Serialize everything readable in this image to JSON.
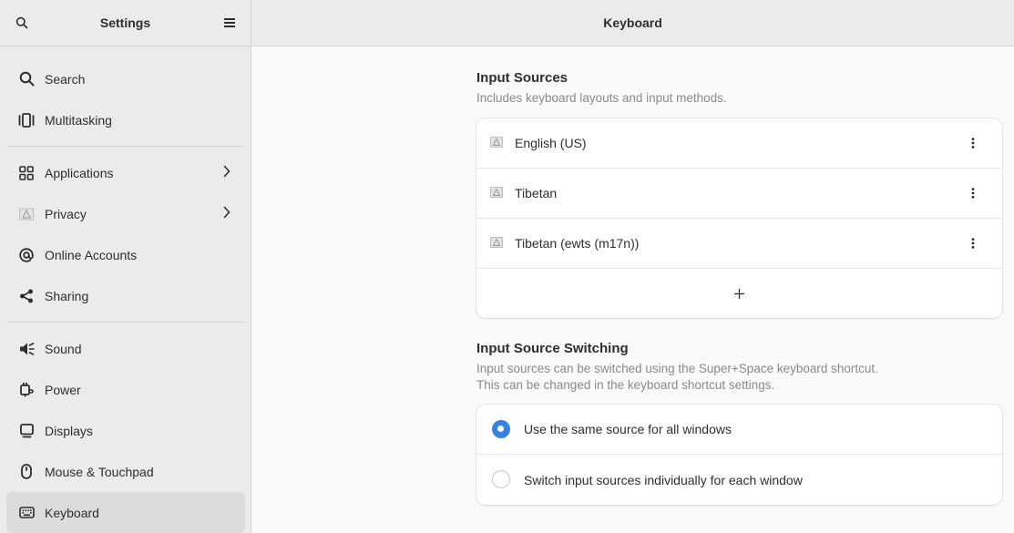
{
  "sidebar": {
    "title": "Settings",
    "items": [
      {
        "label": "Search",
        "icon": "search-icon"
      },
      {
        "label": "Multitasking",
        "icon": "multitasking-icon"
      },
      {
        "label": "Applications",
        "icon": "applications-icon",
        "has_chevron": true
      },
      {
        "label": "Privacy",
        "icon": "privacy-icon",
        "has_chevron": true
      },
      {
        "label": "Online Accounts",
        "icon": "at-sign-icon"
      },
      {
        "label": "Sharing",
        "icon": "share-icon"
      },
      {
        "label": "Sound",
        "icon": "speaker-icon"
      },
      {
        "label": "Power",
        "icon": "power-plug-icon"
      },
      {
        "label": "Displays",
        "icon": "display-icon"
      },
      {
        "label": "Mouse & Touchpad",
        "icon": "mouse-icon"
      },
      {
        "label": "Keyboard",
        "icon": "keyboard-icon",
        "selected": true
      }
    ]
  },
  "content": {
    "title": "Keyboard",
    "input_sources": {
      "title": "Input Sources",
      "subtitle": "Includes keyboard layouts and input methods.",
      "sources": [
        {
          "label": "English (US)"
        },
        {
          "label": "Tibetan"
        },
        {
          "label": "Tibetan (ewts (m17n))"
        }
      ],
      "add_label": "+"
    },
    "switching": {
      "title": "Input Source Switching",
      "subtitle_line1": "Input sources can be switched using the Super+Space keyboard shortcut.",
      "subtitle_line2": "This can be changed in the keyboard shortcut settings.",
      "options": [
        {
          "label": "Use the same source for all windows",
          "checked": true
        },
        {
          "label": "Switch input sources individually for each window",
          "checked": false
        }
      ]
    }
  },
  "colors": {
    "accent": "#3584e4",
    "sidebar_bg": "#ebebeb",
    "content_bg": "#fafafa",
    "selected_bg": "#dcdcdc"
  }
}
